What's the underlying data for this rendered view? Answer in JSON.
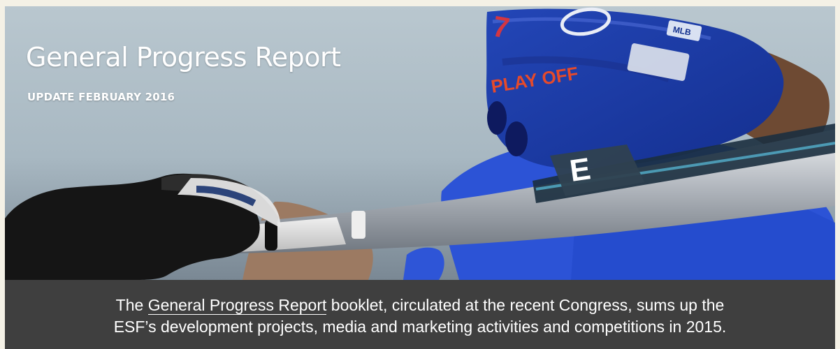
{
  "hero": {
    "title": "General Progress Report",
    "subtitle": "UPDATE FEBRUARY 2016",
    "helmet_text": "PLAY OFF",
    "bat_letter": "E",
    "helmet_number": "7",
    "logo_text": "MLB"
  },
  "caption": {
    "prefix": "The ",
    "link_label": "General Progress Report",
    "suffix_line1": " booklet, circulated at the recent Congress, sums up the",
    "line2": "ESF’s development projects, media and marketing activities and competitions in 2015."
  },
  "colors": {
    "page_background": "#f4f1e6",
    "caption_background": "#3f3f3f",
    "helmet_blue": "#1f3ea9",
    "jersey_blue": "#2f56d8",
    "glove_black": "#111111",
    "bat_silver": "#b8bcc3",
    "text_white": "#ffffff"
  }
}
